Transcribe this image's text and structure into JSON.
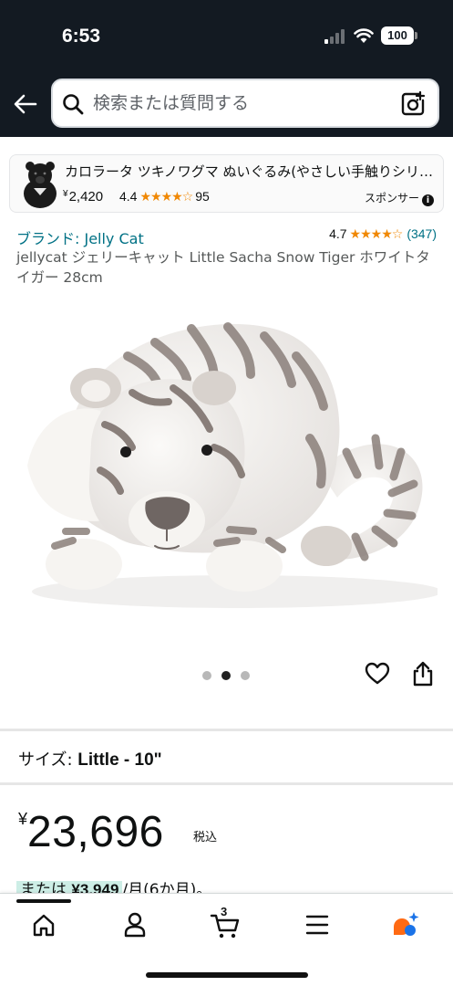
{
  "status_bar": {
    "time": "6:53",
    "battery": "100"
  },
  "search": {
    "placeholder": "検索または質問する"
  },
  "sponsored": {
    "title": "カロラータ ツキノワグマ ぬいぐるみ(やさしい手触りシリーズ)",
    "currency": "¥",
    "price": "2,420",
    "rating": "4.4",
    "review_count": "95",
    "tag": "スポンサー",
    "stars": "★★★★☆"
  },
  "product": {
    "brand": "ブランド: Jelly Cat",
    "rating": "4.7",
    "stars": "★★★★☆",
    "review_count": "(347)",
    "title": "jellycat ジェリーキャット Little Sacha Snow Tiger ホワイトタイガー 28cm",
    "image_index": 2,
    "image_total": 3
  },
  "size": {
    "label": "サイズ: ",
    "value": "Little - 10\""
  },
  "price": {
    "currency": "¥",
    "value": "23,696",
    "tax_note": "税込"
  },
  "installment": {
    "prefix": "または",
    "amount": "¥3,949",
    "suffix": "/月(6か月)。"
  },
  "bottom_nav": {
    "cart_count": "3",
    "active": "home"
  },
  "colors": {
    "header_bg": "#131a22",
    "link": "#007185",
    "star": "#f08804",
    "highlight": "#cdeee6"
  }
}
